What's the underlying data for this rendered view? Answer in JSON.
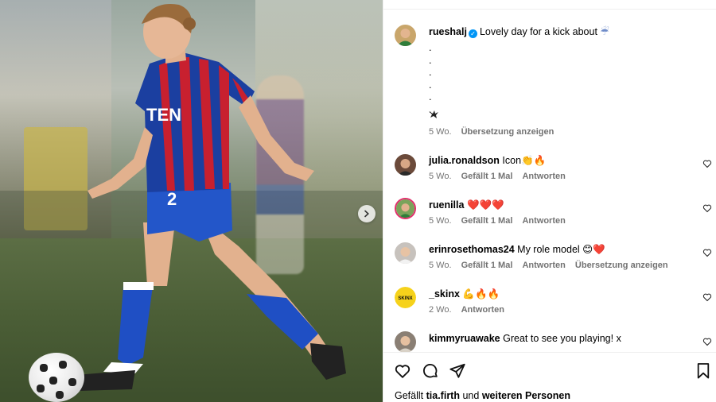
{
  "post": {
    "author": "rueshalj",
    "caption": "Lovely day for a kick about",
    "caption_emoji": "☔",
    "dots": [
      ".",
      ".",
      ".",
      ".",
      ".",
      "."
    ],
    "time": "5 Wo.",
    "translate": "Übersetzung anzeigen"
  },
  "comments": [
    {
      "user": "julia.ronaldson",
      "text": "Icon👏🔥",
      "time": "5 Wo.",
      "likes": "Gefällt 1 Mal",
      "reply": "Antworten",
      "translate": ""
    },
    {
      "user": "ruenilla",
      "text": "❤️❤️❤️",
      "time": "5 Wo.",
      "likes": "Gefällt 1 Mal",
      "reply": "Antworten",
      "translate": ""
    },
    {
      "user": "erinrosethomas24",
      "text": "My role model 😊❤️",
      "time": "5 Wo.",
      "likes": "Gefällt 1 Mal",
      "reply": "Antworten",
      "translate": "Übersetzung anzeigen"
    },
    {
      "user": "_skinx",
      "text": "💪🔥🔥",
      "time": "2 Wo.",
      "likes": "",
      "reply": "Antworten",
      "translate": ""
    },
    {
      "user": "kimmyruawake",
      "text": "Great to see you playing! x",
      "time": "",
      "likes": "",
      "reply": "",
      "translate": ""
    }
  ],
  "footer": {
    "liked_prefix": "Gefällt",
    "liked_user": "tia.firth",
    "liked_mid": "und",
    "liked_suffix": "weiteren Personen"
  },
  "photo": {
    "jersey_text": "TEN",
    "number": "2"
  },
  "colors": {
    "verified": "#0095f6",
    "secondary_text": "#737373",
    "jersey_red": "#c8202f",
    "jersey_blue": "#1b3fa0"
  },
  "icons": [
    "chevron-right-icon",
    "verified-icon",
    "heart-icon",
    "comment-icon",
    "share-icon",
    "bookmark-icon"
  ]
}
